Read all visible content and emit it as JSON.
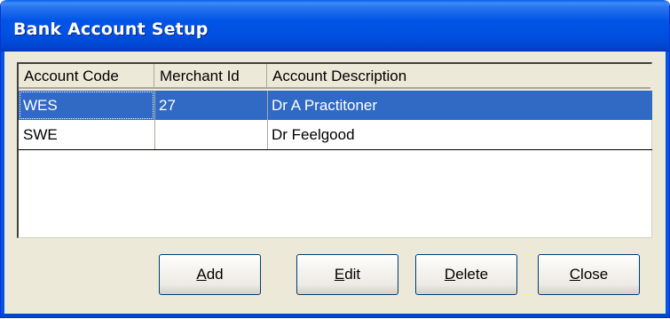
{
  "window": {
    "title": "Bank Account Setup"
  },
  "listview": {
    "columns": [
      "Account Code",
      "Merchant Id",
      "Account Description"
    ],
    "rows": [
      {
        "code": "WES",
        "merchant_id": "27",
        "description": "Dr A Practitoner",
        "selected": true
      },
      {
        "code": "SWE",
        "merchant_id": "",
        "description": "Dr Feelgood",
        "selected": false
      }
    ]
  },
  "buttons": {
    "add": {
      "accel": "A",
      "rest": "dd"
    },
    "edit": {
      "accel": "E",
      "rest": "dit"
    },
    "delete": {
      "accel": "D",
      "rest": "elete"
    },
    "close": {
      "accel": "C",
      "rest": "lose"
    }
  },
  "colors": {
    "selection": "#316ac5",
    "titlebar": "#0055e5",
    "dialog_bg": "#ece9d8"
  }
}
